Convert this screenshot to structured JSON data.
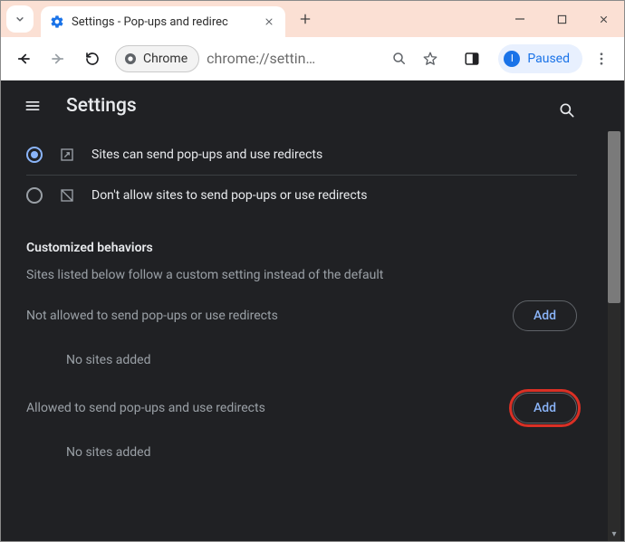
{
  "browser": {
    "tab_title": "Settings - Pop-ups and redirec",
    "origin_chip": "Chrome",
    "url_display": "chrome://settin…",
    "profile_status": "Paused",
    "profile_initial": "I"
  },
  "header": {
    "title": "Settings"
  },
  "options": {
    "allow_label": "Sites can send pop-ups and use redirects",
    "block_label": "Don't allow sites to send pop-ups or use redirects",
    "selected": "allow"
  },
  "customized": {
    "heading": "Customized behaviors",
    "description": "Sites listed below follow a custom setting instead of the default"
  },
  "lists": {
    "blocked": {
      "label": "Not allowed to send pop-ups or use redirects",
      "add_button": "Add",
      "empty": "No sites added"
    },
    "allowed": {
      "label": "Allowed to send pop-ups and use redirects",
      "add_button": "Add",
      "empty": "No sites added"
    }
  }
}
